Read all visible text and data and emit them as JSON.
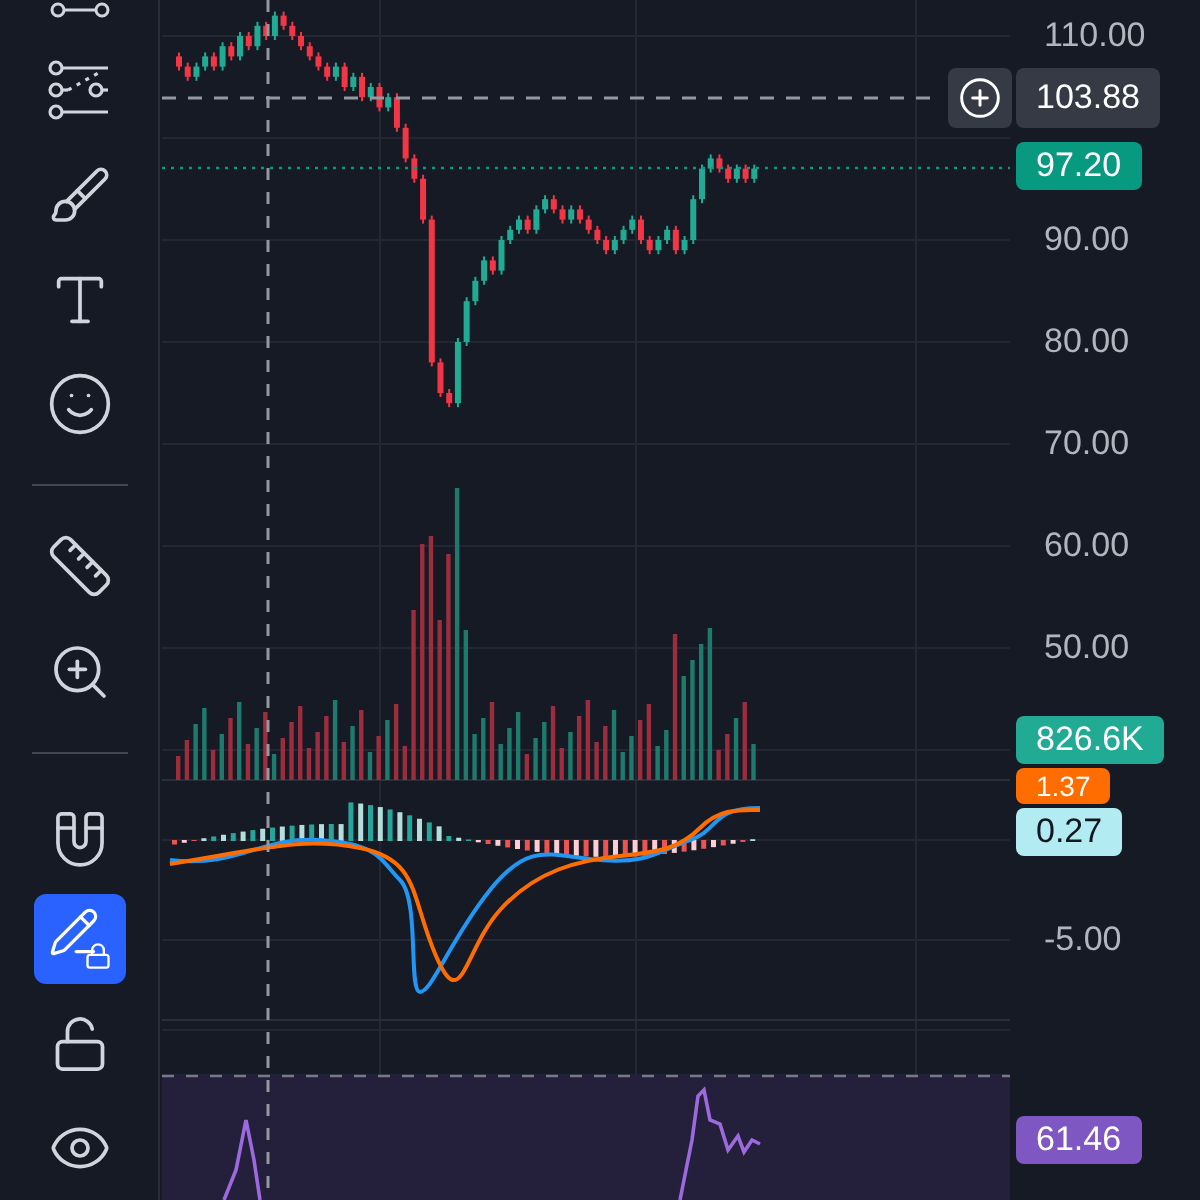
{
  "toolbar": [
    {
      "kind": "fib",
      "selected": false
    },
    {
      "kind": "pattern",
      "selected": false
    },
    {
      "kind": "brush",
      "selected": false
    },
    {
      "kind": "text",
      "selected": false
    },
    {
      "kind": "emoji",
      "selected": false
    },
    {
      "kind": "divider"
    },
    {
      "kind": "ruler",
      "selected": false
    },
    {
      "kind": "zoom",
      "selected": false
    },
    {
      "kind": "divider"
    },
    {
      "kind": "magnet",
      "selected": false
    },
    {
      "kind": "lock_drawing",
      "selected": true
    },
    {
      "kind": "unlock",
      "selected": false
    },
    {
      "kind": "eye",
      "selected": false
    }
  ],
  "price_axis": {
    "ticks": [
      "110.00",
      "90.00",
      "80.00",
      "70.00",
      "60.00",
      "50.00",
      "-5.00"
    ],
    "tags": [
      {
        "kind": "crosshair",
        "text": "103.88"
      },
      {
        "kind": "last_price",
        "text": "97.20",
        "color": "#089981"
      },
      {
        "kind": "volume",
        "text": "826.6K",
        "color": "#22ab94"
      },
      {
        "kind": "macd",
        "text": "1.37",
        "color": "#ff6d00"
      },
      {
        "kind": "signal",
        "text": "0.27",
        "color": "#b2ebf2"
      },
      {
        "kind": "rsi",
        "text": "61.46",
        "color": "#7e57c2"
      }
    ]
  }
}
